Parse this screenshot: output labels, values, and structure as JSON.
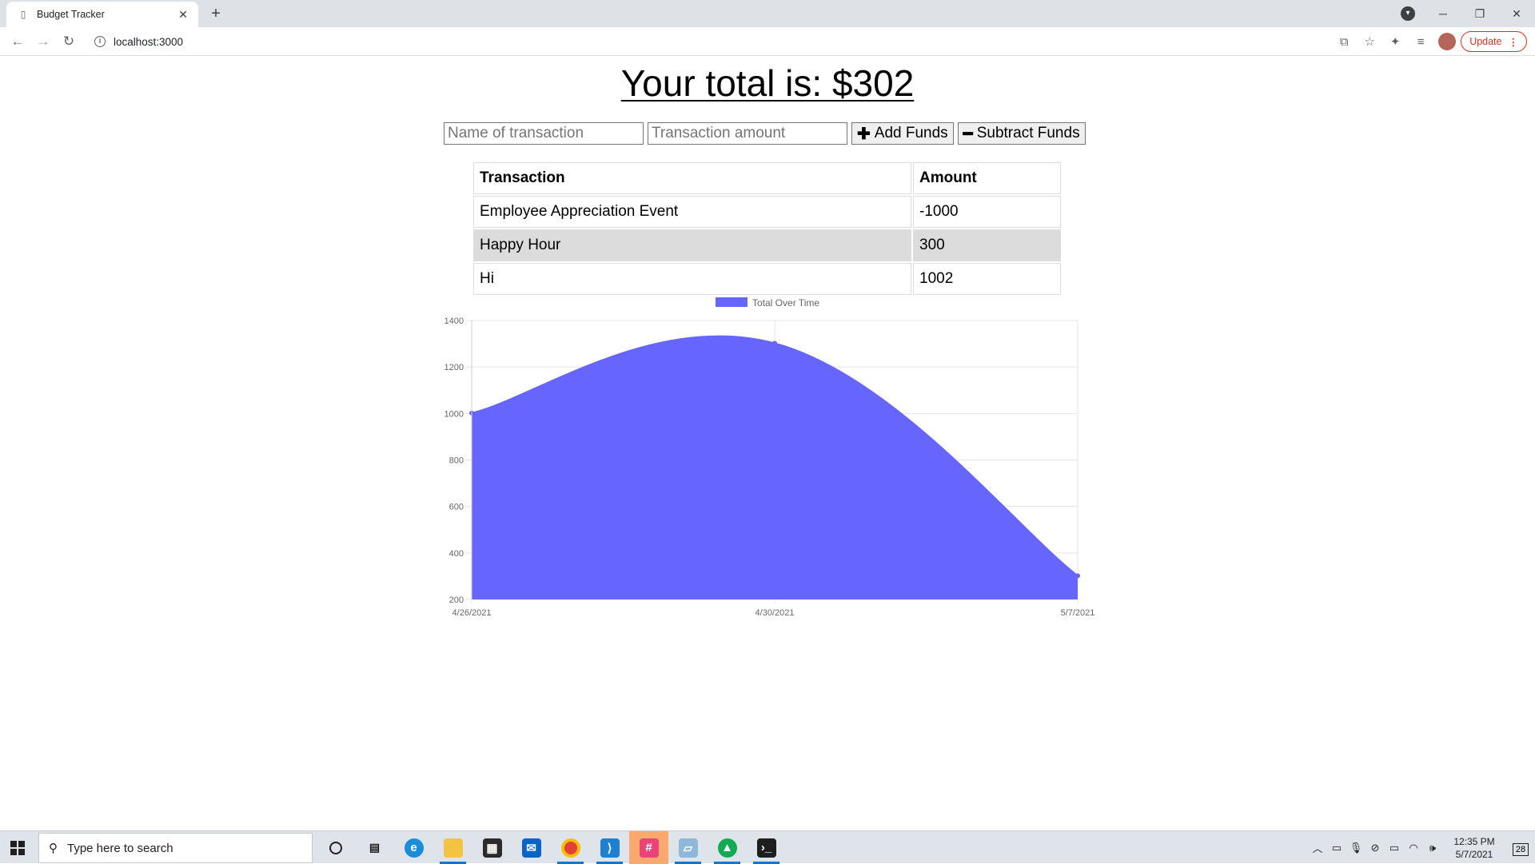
{
  "browser": {
    "tab_title": "Budget Tracker",
    "new_tab": "+",
    "tab_close": "✕",
    "url": "localhost:3000",
    "update_label": "Update",
    "window_controls": [
      "─",
      "❐",
      "✕"
    ]
  },
  "app": {
    "total_text": "Your total is: $302",
    "name_placeholder": "Name of transaction",
    "amount_placeholder": "Transaction amount",
    "add_label": "Add Funds",
    "subtract_label": "Subtract Funds",
    "add_icon": "plus-icon",
    "subtract_icon": "minus-icon"
  },
  "table": {
    "headers": [
      "Transaction",
      "Amount"
    ],
    "rows": [
      {
        "name": "Employee Appreciation Event",
        "amount": "-1000"
      },
      {
        "name": "Happy Hour",
        "amount": "300"
      },
      {
        "name": "Hi",
        "amount": "1002"
      }
    ]
  },
  "chart_data": {
    "type": "area",
    "legend": [
      "Total Over Time"
    ],
    "legend_position": "top",
    "x": [
      "4/26/2021",
      "4/30/2021",
      "5/7/2021"
    ],
    "series": [
      {
        "name": "Total Over Time",
        "values": [
          1002,
          1302,
          302
        ],
        "color": "#6666ff"
      }
    ],
    "yticks": [
      200,
      400,
      600,
      800,
      1000,
      1200,
      1400
    ],
    "ylim": [
      200,
      1400
    ],
    "grid": true
  },
  "taskbar": {
    "search_placeholder": "Type here to search",
    "time": "12:35 PM",
    "date": "5/7/2021",
    "notification_count": "28"
  }
}
